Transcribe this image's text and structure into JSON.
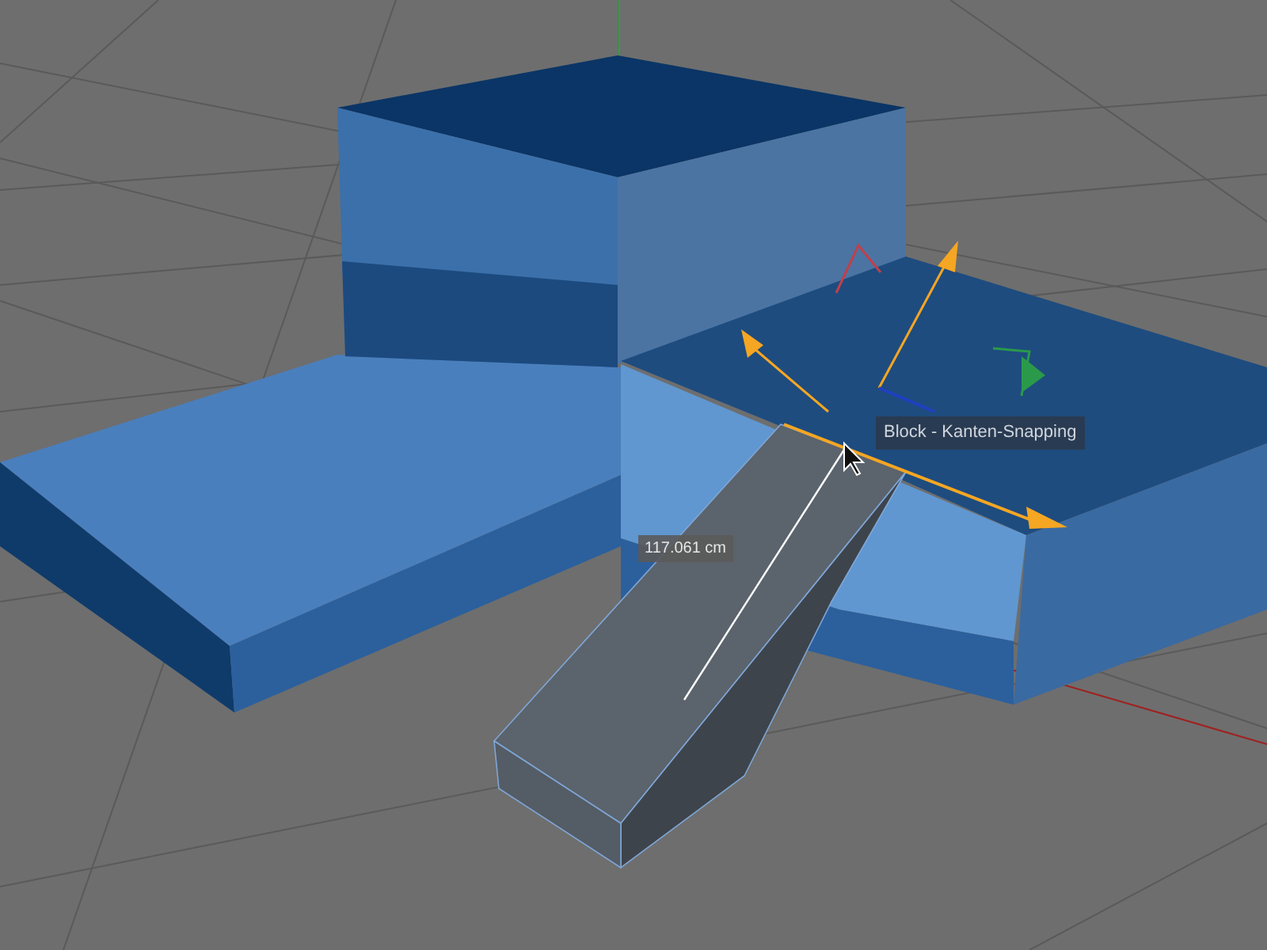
{
  "viewport": {
    "snap_tooltip": "Block - Kanten-Snapping",
    "distance_label": "117.061 cm"
  }
}
